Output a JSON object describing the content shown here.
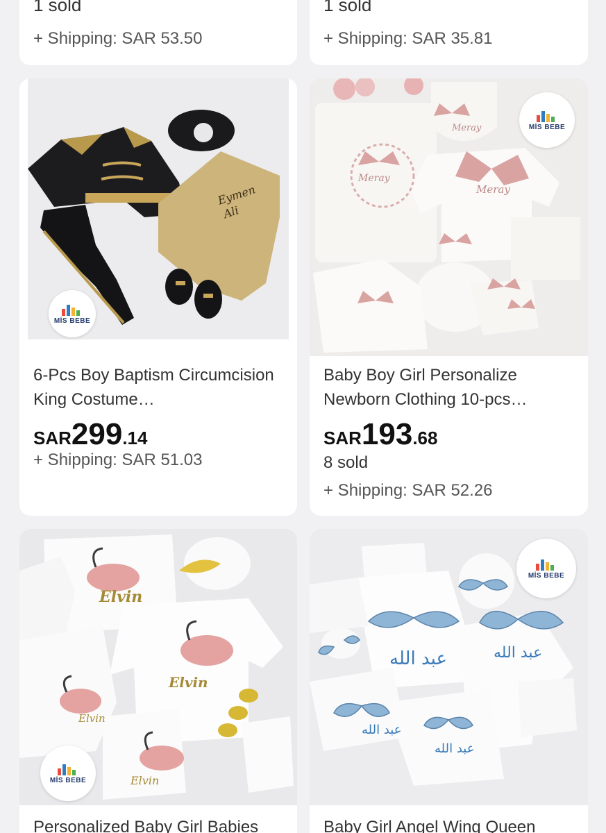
{
  "products": [
    {
      "sold": "1 sold",
      "shipping": "+ Shipping: SAR 53.50"
    },
    {
      "sold": "1 sold",
      "shipping": "+ Shipping: SAR 35.81"
    },
    {
      "title": "6-Pcs Boy Baptism Circumcision King Costume…",
      "price_currency": "SAR",
      "price_int": "299",
      "price_dec": ".14",
      "shipping": "+ Shipping: SAR 51.03",
      "image_text": [
        "Eymen",
        "Ali"
      ],
      "logo_text": "MİS BEBE"
    },
    {
      "title": "Baby Boy Girl Personalize Newborn Clothing 10-pcs…",
      "price_currency": "SAR",
      "price_int": "193",
      "price_dec": ".68",
      "sold": "8 sold",
      "shipping": "+ Shipping: SAR 52.26",
      "image_text": "Meray",
      "logo_text": "MİS BEBE"
    },
    {
      "title": "Personalized Baby Girl Babies",
      "image_text": "Elvin",
      "logo_text": "MİS BEBE"
    },
    {
      "title": "Baby Girl Angel Wing Queen",
      "image_text": "عبد الله",
      "logo_text": "MİS BEBE"
    }
  ],
  "colors": {
    "background": "#f1f1f3",
    "card": "#ffffff",
    "price": "#111111",
    "muted": "#555555",
    "logo_text": "#233a6b"
  }
}
